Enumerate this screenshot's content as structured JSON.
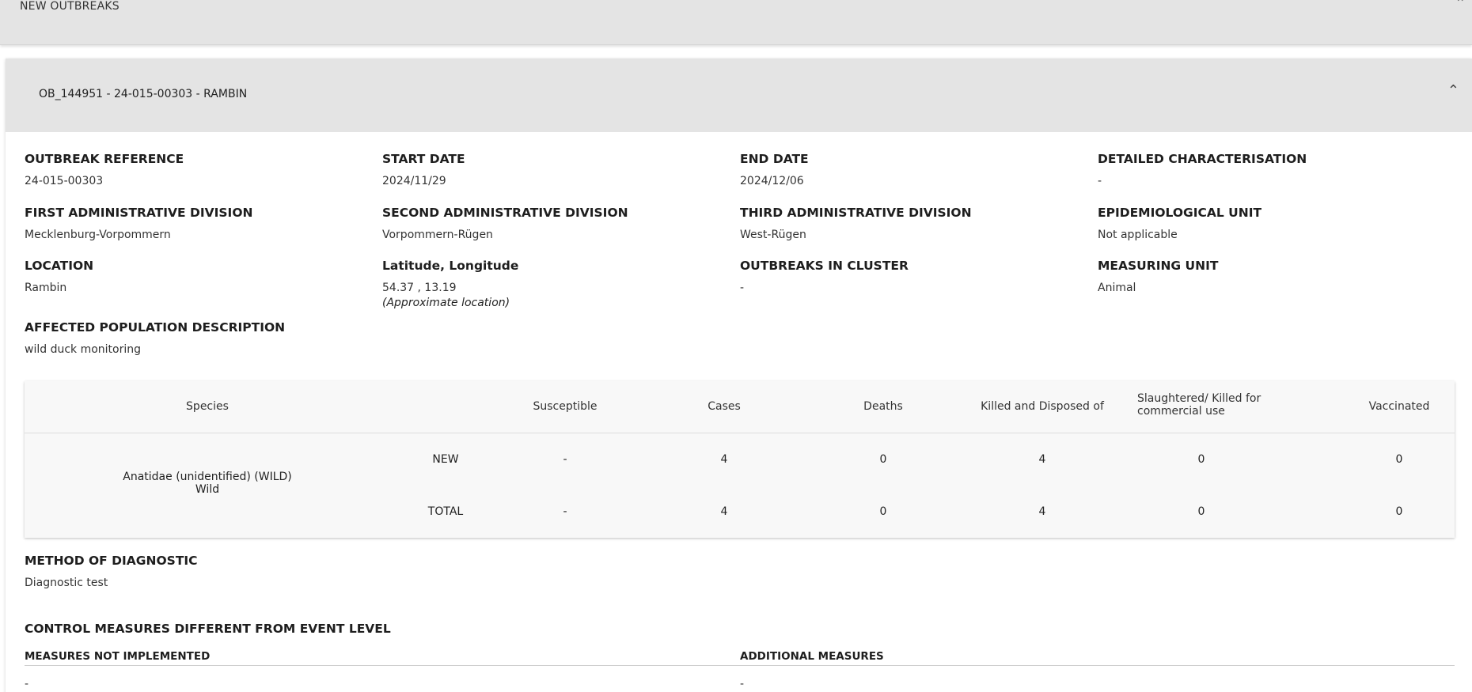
{
  "top_section": {
    "title": "NEW OUTBREAKS"
  },
  "outbreak": {
    "header_title": "OB_144951 - 24-015-00303 - RAMBIN",
    "fields": {
      "outbreak_reference": {
        "label": "OUTBREAK REFERENCE",
        "value": "24-015-00303"
      },
      "start_date": {
        "label": "START DATE",
        "value": "2024/11/29"
      },
      "end_date": {
        "label": "END DATE",
        "value": "2024/12/06"
      },
      "detailed_characterisation": {
        "label": "DETAILED CHARACTERISATION",
        "value": "-"
      },
      "first_admin_division": {
        "label": "FIRST ADMINISTRATIVE DIVISION",
        "value": "Mecklenburg-Vorpommern"
      },
      "second_admin_division": {
        "label": "SECOND ADMINISTRATIVE DIVISION",
        "value": "Vorpommern-Rügen"
      },
      "third_admin_division": {
        "label": "THIRD ADMINISTRATIVE DIVISION",
        "value": "West-Rügen"
      },
      "epidemiological_unit": {
        "label": "EPIDEMIOLOGICAL UNIT",
        "value": "Not applicable"
      },
      "location": {
        "label": "LOCATION",
        "value": "Rambin"
      },
      "lat_long": {
        "label": "Latitude, Longitude",
        "value": "54.37 , 13.19",
        "note": "(Approximate location)"
      },
      "outbreaks_in_cluster": {
        "label": "OUTBREAKS IN CLUSTER",
        "value": "-"
      },
      "measuring_unit": {
        "label": "MEASURING UNIT",
        "value": "Animal"
      },
      "affected_population": {
        "label": "AFFECTED POPULATION DESCRIPTION",
        "value": "wild duck monitoring"
      }
    },
    "table": {
      "headers": {
        "species": "Species",
        "susceptible": "Susceptible",
        "cases": "Cases",
        "deaths": "Deaths",
        "killed": "Killed and Disposed of",
        "slaughtered_1": "Slaughtered/ Killed for",
        "slaughtered_2": "commercial use",
        "vaccinated": "Vaccinated"
      },
      "species_name": "Anatidae (unidentified) (WILD)",
      "species_type": "Wild",
      "rows": [
        {
          "kind": "NEW",
          "susceptible": "-",
          "cases": "4",
          "deaths": "0",
          "killed": "4",
          "slaughtered": "0",
          "vaccinated": "0"
        },
        {
          "kind": "TOTAL",
          "susceptible": "-",
          "cases": "4",
          "deaths": "0",
          "killed": "4",
          "slaughtered": "0",
          "vaccinated": "0"
        }
      ]
    },
    "method_of_diagnostic": {
      "label": "METHOD OF DIAGNOSTIC",
      "value": "Diagnostic test"
    },
    "control_measures": {
      "title": "CONTROL MEASURES DIFFERENT FROM EVENT LEVEL",
      "not_implemented_label": "MEASURES NOT IMPLEMENTED",
      "not_implemented_value": "-",
      "additional_label": "ADDITIONAL MEASURES",
      "additional_value": "-"
    }
  }
}
